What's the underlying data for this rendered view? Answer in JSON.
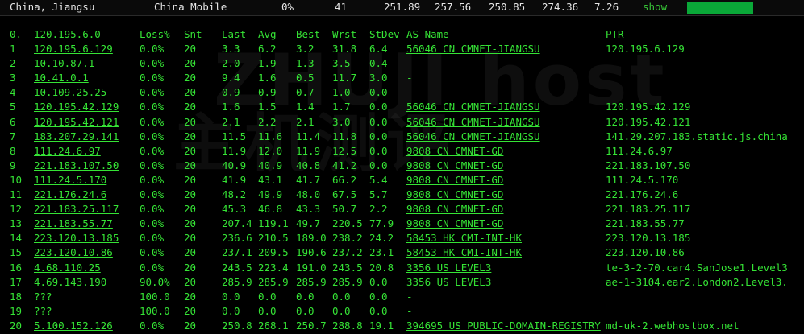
{
  "header": {
    "location": "China, Jiangsu",
    "isp": "China Mobile",
    "loss": "0%",
    "hops": "41",
    "v1": "251.89",
    "v2": "257.56",
    "v3": "250.85",
    "v4": "274.36",
    "v5": "7.26",
    "show_label": "show"
  },
  "columns": {
    "idx": "0.",
    "host": "120.195.6.0",
    "loss": "Loss%",
    "snt": "Snt",
    "last": "Last",
    "avg": "Avg",
    "best": "Best",
    "wrst": "Wrst",
    "stdev": "StDev",
    "as": "AS Name",
    "ptr": "PTR"
  },
  "rows": [
    {
      "idx": "1",
      "host": "120.195.6.129",
      "loss": "0.0%",
      "snt": "20",
      "last": "3.3",
      "avg": "6.2",
      "best": "3.2",
      "wrst": "31.8",
      "stdev": "6.4",
      "as": "56046 CN CMNET-JIANGSU",
      "ptr": "120.195.6.129"
    },
    {
      "idx": "2",
      "host": "10.10.87.1",
      "loss": "0.0%",
      "snt": "20",
      "last": "2.0",
      "avg": "1.9",
      "best": "1.3",
      "wrst": "3.5",
      "stdev": "0.4",
      "as": "-",
      "ptr": ""
    },
    {
      "idx": "3",
      "host": "10.41.0.1",
      "loss": "0.0%",
      "snt": "20",
      "last": "9.4",
      "avg": "1.6",
      "best": "0.5",
      "wrst": "11.7",
      "stdev": "3.0",
      "as": "-",
      "ptr": ""
    },
    {
      "idx": "4",
      "host": "10.109.25.25",
      "loss": "0.0%",
      "snt": "20",
      "last": "0.9",
      "avg": "0.9",
      "best": "0.7",
      "wrst": "1.0",
      "stdev": "0.0",
      "as": "-",
      "ptr": ""
    },
    {
      "idx": "5",
      "host": "120.195.42.129",
      "loss": "0.0%",
      "snt": "20",
      "last": "1.6",
      "avg": "1.5",
      "best": "1.4",
      "wrst": "1.7",
      "stdev": "0.0",
      "as": "56046 CN CMNET-JIANGSU",
      "ptr": "120.195.42.129"
    },
    {
      "idx": "6",
      "host": "120.195.42.121",
      "loss": "0.0%",
      "snt": "20",
      "last": "2.1",
      "avg": "2.2",
      "best": "2.1",
      "wrst": "3.0",
      "stdev": "0.0",
      "as": "56046 CN CMNET-JIANGSU",
      "ptr": "120.195.42.121"
    },
    {
      "idx": "7",
      "host": "183.207.29.141",
      "loss": "0.0%",
      "snt": "20",
      "last": "11.5",
      "avg": "11.6",
      "best": "11.4",
      "wrst": "11.8",
      "stdev": "0.0",
      "as": "56046 CN CMNET-JIANGSU",
      "ptr": "141.29.207.183.static.js.china"
    },
    {
      "idx": "8",
      "host": "111.24.6.97",
      "loss": "0.0%",
      "snt": "20",
      "last": "11.9",
      "avg": "12.0",
      "best": "11.9",
      "wrst": "12.5",
      "stdev": "0.0",
      "as": "9808 CN CMNET-GD",
      "ptr": "111.24.6.97"
    },
    {
      "idx": "9",
      "host": "221.183.107.50",
      "loss": "0.0%",
      "snt": "20",
      "last": "40.9",
      "avg": "40.9",
      "best": "40.8",
      "wrst": "41.2",
      "stdev": "0.0",
      "as": "9808 CN CMNET-GD",
      "ptr": "221.183.107.50"
    },
    {
      "idx": "10",
      "host": "111.24.5.170",
      "loss": "0.0%",
      "snt": "20",
      "last": "41.9",
      "avg": "43.1",
      "best": "41.7",
      "wrst": "66.2",
      "stdev": "5.4",
      "as": "9808 CN CMNET-GD",
      "ptr": "111.24.5.170"
    },
    {
      "idx": "11",
      "host": "221.176.24.6",
      "loss": "0.0%",
      "snt": "20",
      "last": "48.2",
      "avg": "49.9",
      "best": "48.0",
      "wrst": "67.5",
      "stdev": "5.7",
      "as": "9808 CN CMNET-GD",
      "ptr": "221.176.24.6"
    },
    {
      "idx": "12",
      "host": "221.183.25.117",
      "loss": "0.0%",
      "snt": "20",
      "last": "45.3",
      "avg": "46.8",
      "best": "43.3",
      "wrst": "50.7",
      "stdev": "2.2",
      "as": "9808 CN CMNET-GD",
      "ptr": "221.183.25.117"
    },
    {
      "idx": "13",
      "host": "221.183.55.77",
      "loss": "0.0%",
      "snt": "20",
      "last": "207.4",
      "avg": "119.1",
      "best": "49.7",
      "wrst": "220.5",
      "stdev": "77.9",
      "as": "9808 CN CMNET-GD",
      "ptr": "221.183.55.77"
    },
    {
      "idx": "14",
      "host": "223.120.13.185",
      "loss": "0.0%",
      "snt": "20",
      "last": "236.6",
      "avg": "210.5",
      "best": "189.0",
      "wrst": "238.2",
      "stdev": "24.2",
      "as": "58453 HK CMI-INT-HK",
      "ptr": "223.120.13.185"
    },
    {
      "idx": "15",
      "host": "223.120.10.86",
      "loss": "0.0%",
      "snt": "20",
      "last": "237.1",
      "avg": "209.5",
      "best": "190.6",
      "wrst": "237.2",
      "stdev": "23.1",
      "as": "58453 HK CMI-INT-HK",
      "ptr": "223.120.10.86"
    },
    {
      "idx": "16",
      "host": "4.68.110.25",
      "loss": "0.0%",
      "snt": "20",
      "last": "243.5",
      "avg": "223.4",
      "best": "191.0",
      "wrst": "243.5",
      "stdev": "20.8",
      "as": "3356 US LEVEL3",
      "ptr": "te-3-2-70.car4.SanJose1.Level3"
    },
    {
      "idx": "17",
      "host": "4.69.143.190",
      "loss": "90.0%",
      "snt": "20",
      "last": "285.9",
      "avg": "285.9",
      "best": "285.9",
      "wrst": "285.9",
      "stdev": "0.0",
      "as": "3356 US LEVEL3",
      "ptr": "ae-1-3104.ear2.London2.Level3."
    },
    {
      "idx": "18",
      "host": "???",
      "loss": "100.0",
      "snt": "20",
      "last": "0.0",
      "avg": "0.0",
      "best": "0.0",
      "wrst": "0.0",
      "stdev": "0.0",
      "as": "-",
      "ptr": ""
    },
    {
      "idx": "19",
      "host": "???",
      "loss": "100.0",
      "snt": "20",
      "last": "0.0",
      "avg": "0.0",
      "best": "0.0",
      "wrst": "0.0",
      "stdev": "0.0",
      "as": "-",
      "ptr": ""
    },
    {
      "idx": "20",
      "host": "5.100.152.126",
      "loss": "0.0%",
      "snt": "20",
      "last": "250.8",
      "avg": "268.1",
      "best": "250.7",
      "wrst": "288.8",
      "stdev": "19.1",
      "as": "394695 US PUBLIC-DOMAIN-REGISTRY",
      "ptr": "md-uk-2.webhostbox.net"
    }
  ]
}
